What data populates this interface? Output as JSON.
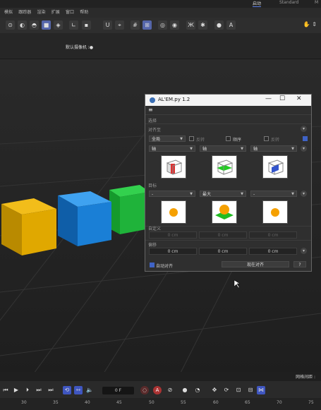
{
  "topbar": {
    "tab_active": "启动",
    "tab_standard": "Standard",
    "tab_extra": "M"
  },
  "menu": [
    "模拟",
    "跟踪器",
    "渲染",
    "扩展",
    "窗口",
    "帮助"
  ],
  "toolbar": {
    "icons": [
      "move-icon",
      "scale-icon",
      "rotate-icon",
      "cube-icon",
      "model-icon",
      "points-icon",
      "edges-icon",
      "magnet-icon",
      "axis-icon",
      "snap-icon",
      "grid-icon",
      "light-icon",
      "render-icon",
      "butterfly-icon",
      "gear-icon",
      "sphere-icon",
      "a-icon"
    ]
  },
  "viewport": {
    "camera_label": "默认摄像机 ⁝●",
    "status_right": "网格间距 : "
  },
  "plugin": {
    "title": "AL'EM.py 1.2",
    "menu_icon": "≡",
    "section_select": "选择",
    "section_align": "对齐至",
    "align_target": "全局",
    "opt1": "反转",
    "opt2": "顺序",
    "opt3": "反转",
    "axis_selects": [
      "轴",
      "轴",
      "轴"
    ],
    "section_target": "目标",
    "target_selects": [
      "-",
      "最大",
      "-"
    ],
    "section_custom": "自定义",
    "custom_values": [
      "0 cm",
      "0 cm",
      "0 cm"
    ],
    "section_offset": "偏移",
    "offset_values": [
      "0 cm",
      "0 cm",
      "0 cm"
    ],
    "auto_align_label": "自动对齐",
    "align_now": "现在对齐",
    "help": "?"
  },
  "timeline": {
    "frame": "0 F",
    "ruler": [
      "30",
      "35",
      "40",
      "45",
      "50",
      "55",
      "60",
      "65",
      "70",
      "75"
    ]
  },
  "colors": {
    "accent": "#3f56c0",
    "record": "#aa3333",
    "cube_yellow": "#e0a800",
    "cube_blue": "#1a7fd6",
    "cube_green": "#1fb33a"
  }
}
